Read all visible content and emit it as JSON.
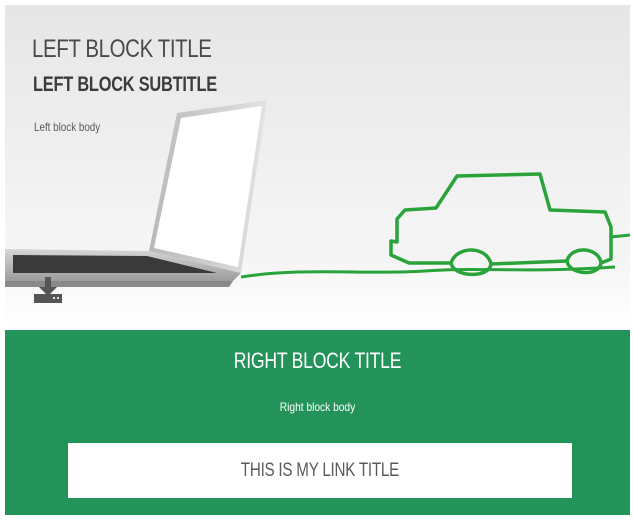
{
  "left_block": {
    "title": "LEFT BLOCK TITLE",
    "subtitle": "LEFT BLOCK SUBTITLE",
    "body": "Left block body",
    "icon": "download-icon"
  },
  "right_block": {
    "title": "RIGHT BLOCK TITLE",
    "body": "Right block body",
    "link_title": "THIS IS MY LINK TITLE"
  },
  "colors": {
    "green_panel": "#24935a",
    "cable_green": "#2aa43a",
    "link_background": "#ffffff"
  }
}
